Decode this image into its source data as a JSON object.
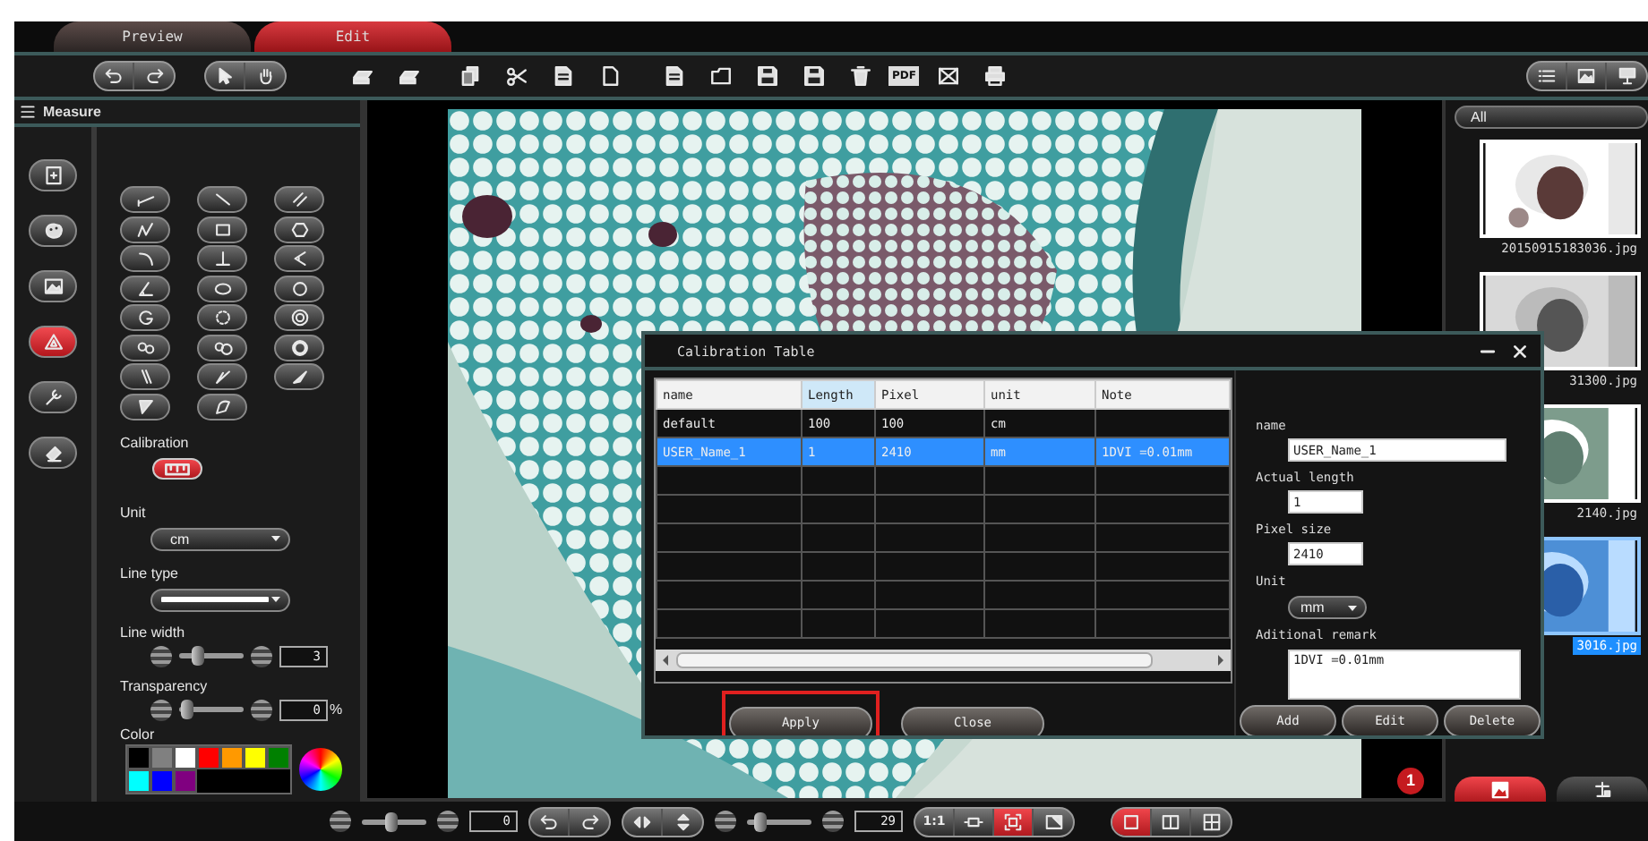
{
  "tabs": [
    {
      "label": "Preview",
      "selected": false
    },
    {
      "label": "Edit",
      "selected": true
    }
  ],
  "toolbar": {
    "pdf_label": "PDF"
  },
  "measure_panel": {
    "title": "Measure",
    "categories": [
      {
        "selected": false
      },
      {
        "selected": false
      },
      {
        "selected": false
      },
      {
        "selected": true
      },
      {
        "selected": false
      },
      {
        "selected": false
      }
    ],
    "calibration_label": "Calibration",
    "unit": {
      "label": "Unit",
      "value": "cm"
    },
    "line_type": {
      "label": "Line type"
    },
    "line_width": {
      "label": "Line width",
      "level": 0.25,
      "value": "3"
    },
    "transparency": {
      "label": "Transparency",
      "level": 0.05,
      "value": "0",
      "suffix": "%"
    },
    "color": {
      "label": "Color",
      "swatches": [
        {
          "color": "#000000"
        },
        {
          "color": "#808080"
        },
        {
          "color": "#ffffff"
        },
        {
          "color": "#ff0000"
        },
        {
          "color": "#ff9900"
        },
        {
          "color": "#ffff00"
        },
        {
          "color": "#008000"
        },
        {
          "color": "#00ffff"
        },
        {
          "color": "#0000ff"
        },
        {
          "color": "#800080"
        }
      ]
    }
  },
  "viewer": {
    "badge": "1"
  },
  "file_panel": {
    "filter": "All",
    "thumbnails": [
      {
        "caption": "20150915183036.jpg",
        "selected": false
      },
      {
        "caption": "31300.jpg",
        "selected": false
      },
      {
        "caption": "2140.jpg",
        "selected": false
      },
      {
        "caption": "3016.jpg",
        "selected": true
      }
    ],
    "tabs": [
      {
        "selected": true
      },
      {
        "selected": false
      }
    ]
  },
  "dialog": {
    "title": "Calibration Table",
    "table": {
      "columns": [
        {
          "label": "name",
          "sorted": false
        },
        {
          "label": "Length",
          "sorted": true
        },
        {
          "label": "Pixel",
          "sorted": false
        },
        {
          "label": "unit",
          "sorted": false
        },
        {
          "label": "Note",
          "sorted": false
        }
      ],
      "rows": [
        {
          "cells": [
            "default",
            "100",
            "100",
            "cm",
            ""
          ],
          "selected": false
        },
        {
          "cells": [
            "USER_Name_1",
            "1",
            "2410",
            "mm",
            "1DVI =0.01mm"
          ],
          "selected": true
        }
      ]
    },
    "buttons": [
      {
        "label": "Apply",
        "highlighted": true
      },
      {
        "label": "Close",
        "highlighted": false
      }
    ],
    "form": {
      "name_label": "name",
      "name_value": "USER_Name_1",
      "length_label": "Actual length",
      "length_value": "1",
      "pixel_label": "Pixel size",
      "pixel_value": "2410",
      "unit_label": "Unit",
      "unit_value": "mm",
      "remark_label": "Aditional remark",
      "remark_value": "1DVI =0.01mm"
    },
    "form_buttons": [
      "Add",
      "Edit",
      "Delete"
    ]
  },
  "bottom_bar": {
    "rotate": {
      "level": 0.45,
      "value": "0"
    },
    "zoom": {
      "level": 0.15,
      "value": "29"
    },
    "view_modes": [
      {
        "label": "1:1",
        "selected": false
      },
      {
        "selected": false
      },
      {
        "selected": true
      },
      {
        "selected": false
      }
    ],
    "layouts": [
      {
        "selected": true
      },
      {
        "selected": false
      },
      {
        "selected": false
      }
    ]
  }
}
